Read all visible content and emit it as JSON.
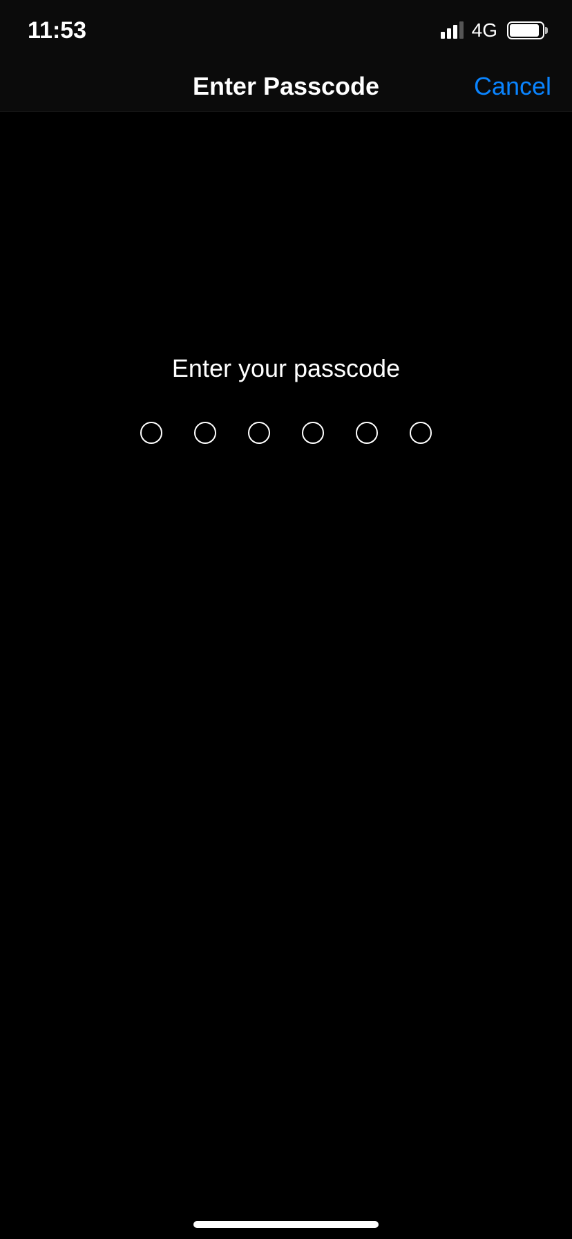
{
  "statusBar": {
    "time": "11:53",
    "network": "4G",
    "signalStrength": 3,
    "signalMax": 4
  },
  "navBar": {
    "title": "Enter Passcode",
    "cancel": "Cancel"
  },
  "content": {
    "prompt": "Enter your passcode",
    "passcodeLength": 6,
    "filledCount": 0
  }
}
